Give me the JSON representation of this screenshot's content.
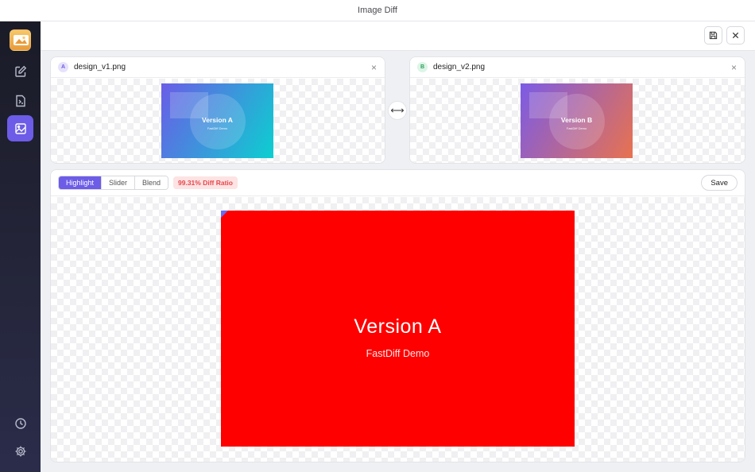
{
  "window": {
    "title": "Image Diff"
  },
  "sidebar": {
    "items": [
      {
        "name": "edit",
        "icon": "edit-icon",
        "active": false
      },
      {
        "name": "file-code",
        "icon": "file-code-icon",
        "active": false
      },
      {
        "name": "image-diff",
        "icon": "image-diff-icon",
        "active": true
      }
    ],
    "bottom": [
      {
        "name": "history",
        "icon": "clock-icon"
      },
      {
        "name": "settings",
        "icon": "gear-icon"
      }
    ]
  },
  "toolbar": {
    "save_icon": "floppy-icon",
    "close_icon": "close-icon"
  },
  "image_a": {
    "badge": "A",
    "filename": "design_v1.png",
    "close": "×",
    "preview_title": "Version A",
    "preview_subtitle": "FastDiff Demo",
    "gradient": [
      "#6b5ce7",
      "#0ccfd0"
    ]
  },
  "image_b": {
    "badge": "B",
    "filename": "design_v2.png",
    "close": "×",
    "preview_title": "Version B",
    "preview_subtitle": "FastDiff Demo",
    "gradient": [
      "#7b5be6",
      "#e8724f"
    ]
  },
  "swap_icon": "⟷",
  "diff": {
    "modes": [
      "Highlight",
      "Slider",
      "Blend"
    ],
    "active_mode": "Highlight",
    "ratio_label": "99.31% Diff Ratio",
    "save_label": "Save",
    "preview_title": "Version A",
    "preview_subtitle": "FastDiff Demo",
    "highlight_color": "#ff0000"
  },
  "colors": {
    "accent": "#6c5ce7",
    "danger": "#e5484d"
  }
}
